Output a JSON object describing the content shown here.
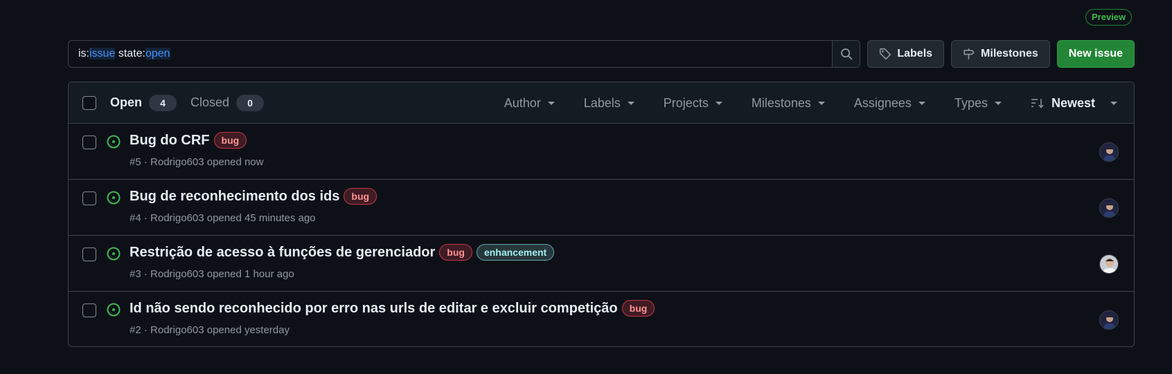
{
  "preview_badge": "Preview",
  "search": {
    "tokens": [
      {
        "key": "is:",
        "value": "issue"
      },
      {
        "key": "state:",
        "value": "open"
      }
    ]
  },
  "toolbar": {
    "labels": "Labels",
    "milestones": "Milestones",
    "new_issue": "New issue"
  },
  "tabs": {
    "open_label": "Open",
    "open_count": "4",
    "closed_label": "Closed",
    "closed_count": "0"
  },
  "filters": [
    "Author",
    "Labels",
    "Projects",
    "Milestones",
    "Assignees",
    "Types"
  ],
  "sort": "Newest",
  "issues": [
    {
      "title": "Bug do CRF",
      "labels": [
        {
          "name": "bug",
          "kind": "bug"
        }
      ],
      "meta": "#5 · Rodrigo603 opened now",
      "avatar": "avatar-dark"
    },
    {
      "title": "Bug de reconhecimento dos ids",
      "labels": [
        {
          "name": "bug",
          "kind": "bug"
        }
      ],
      "meta": "#4 · Rodrigo603 opened 45 minutes ago",
      "avatar": "avatar-dark"
    },
    {
      "title": "Restrição de acesso à funções de gerenciador",
      "labels": [
        {
          "name": "bug",
          "kind": "bug"
        },
        {
          "name": "enhancement",
          "kind": "enhancement"
        }
      ],
      "meta": "#3 · Rodrigo603 opened 1 hour ago",
      "avatar": "avatar-light"
    },
    {
      "title": "Id não sendo reconhecido por erro nas urls de editar e excluir competição",
      "labels": [
        {
          "name": "bug",
          "kind": "bug"
        }
      ],
      "meta": "#2 · Rodrigo603 opened yesterday",
      "avatar": "avatar-dark"
    }
  ],
  "colors": {
    "background": "#0d1117",
    "accent_green": "#238636",
    "open_icon": "#3fb950",
    "link_blue": "#4493f8"
  }
}
